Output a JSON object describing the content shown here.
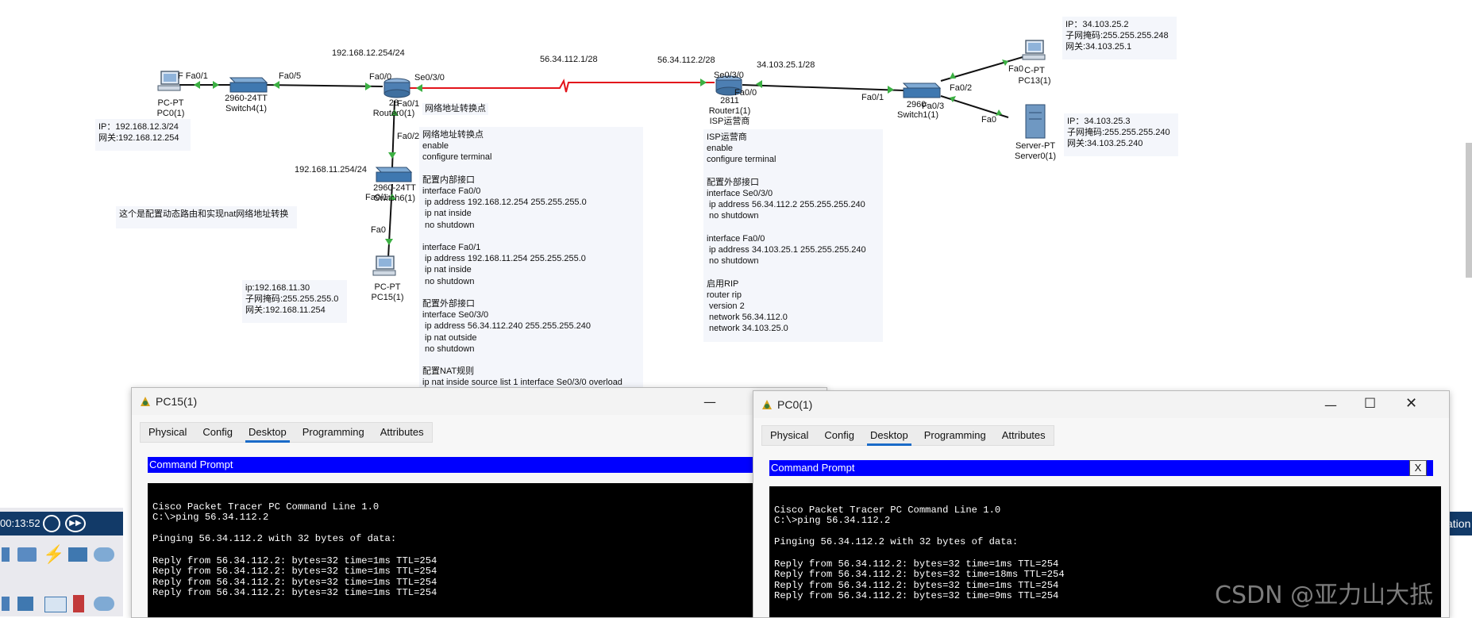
{
  "topology": {
    "devices": [
      {
        "id": "pc0",
        "type": "PC-PT",
        "name": "PC0(1)"
      },
      {
        "id": "switch4",
        "type": "2960-24TT",
        "name": "Switch4(1)"
      },
      {
        "id": "router0",
        "type": "28",
        "name": "Router0(1)"
      },
      {
        "id": "router1",
        "type": "2811",
        "name": "Router1(1)",
        "extra": "ISP运营商"
      },
      {
        "id": "switch1",
        "type": "2960-",
        "name": "Switch1(1)"
      },
      {
        "id": "pc13",
        "type": "C-PT",
        "name": "PC13(1)"
      },
      {
        "id": "server0",
        "type": "Server-PT",
        "name": "Server0(1)"
      },
      {
        "id": "switch6",
        "type": "2960-24TT",
        "name": "Switch6(1)"
      },
      {
        "id": "pc15",
        "type": "PC-PT",
        "name": "PC15(1)"
      }
    ],
    "port_labels": {
      "pc0_fa": "F Fa0/1",
      "sw4_fa05": "Fa0/5",
      "r0_fa00": "Fa0/0",
      "r0_se030": "Se0/3/0",
      "r0_fa01": "Fa0/1",
      "sw6_fa02": "Fa0/2",
      "sw6_fa01": "Fa0/1",
      "pc15_fa0": "Fa0",
      "r1_se030": "Se0/3/0",
      "r1_fa00": "Fa0/0",
      "sw1_fa01": "Fa0/1",
      "sw1_fa02": "Fa0/2",
      "sw1_fa03": "Fa0/3",
      "pc13_fa0": "Fa0",
      "server0_fa0": "Fa0"
    },
    "net_labels": {
      "lan12": "192.168.12.254/24",
      "wan_left": "56.34.112.1/28",
      "wan_right": "56.34.112.2/28",
      "lan34": "34.103.25.1/28",
      "lan11": "192.168.11.254/24",
      "nat_label": "网络地址转换点"
    },
    "colors": {
      "link": "#111111",
      "serial_link": "#e3141b",
      "port_up": "#3cb043"
    }
  },
  "notes": {
    "pc0_info": [
      "IP：192.168.12.3/24",
      "网关:192.168.12.254"
    ],
    "pc13_info": [
      "IP：34.103.25.2",
      "子网掩码:255.255.255.248",
      "网关:34.103.25.1"
    ],
    "server0_info": [
      "IP：34.103.25.3",
      "子网掩码:255.255.255.240",
      "网关:34.103.25.240"
    ],
    "pc15_info": [
      "ip:192.168.11.30",
      "子网掩码:255.255.255.0",
      "网关:192.168.11.254"
    ],
    "description": "这个是配置动态路由和实现nat网络地址转换",
    "router0_config": [
      "网络地址转换点",
      "enable",
      "configure terminal",
      "",
      "配置内部接口",
      "interface Fa0/0",
      " ip address 192.168.12.254 255.255.255.0",
      " ip nat inside",
      " no shutdown",
      "",
      "interface Fa0/1",
      " ip address 192.168.11.254 255.255.255.0",
      " ip nat inside",
      " no shutdown",
      "",
      "配置外部接口",
      "interface Se0/3/0",
      " ip address 56.34.112.240 255.255.255.240",
      " ip nat outside",
      " no shutdown",
      "",
      "配置NAT规则",
      "ip nat inside source list 1 interface Se0/3/0 overload"
    ],
    "router1_config": [
      "ISP运营商",
      "enable",
      "configure terminal",
      "",
      "配置外部接口",
      "interface Se0/3/0",
      " ip address 56.34.112.2 255.255.255.240",
      " no shutdown",
      "",
      "interface Fa0/0",
      " ip address 34.103.25.1 255.255.255.240",
      " no shutdown",
      "",
      "启用RIP",
      "router rip",
      " version 2",
      " network 56.34.112.0",
      " network 34.103.25.0"
    ]
  },
  "windows": {
    "pc15": {
      "title": "PC15(1)",
      "tabs": [
        "Physical",
        "Config",
        "Desktop",
        "Programming",
        "Attributes"
      ],
      "active_tab": "Desktop",
      "cmd_title": "Command Prompt",
      "lines": [
        "",
        "Cisco Packet Tracer PC Command Line 1.0",
        "C:\\>ping 56.34.112.2",
        "",
        "Pinging 56.34.112.2 with 32 bytes of data:",
        "",
        "Reply from 56.34.112.2: bytes=32 time=1ms TTL=254",
        "Reply from 56.34.112.2: bytes=32 time=1ms TTL=254",
        "Reply from 56.34.112.2: bytes=32 time=1ms TTL=254",
        "Reply from 56.34.112.2: bytes=32 time=1ms TTL=254"
      ]
    },
    "pc0": {
      "title": "PC0(1)",
      "tabs": [
        "Physical",
        "Config",
        "Desktop",
        "Programming",
        "Attributes"
      ],
      "active_tab": "Desktop",
      "cmd_title": "Command Prompt",
      "close_label": "X",
      "lines": [
        "",
        "Cisco Packet Tracer PC Command Line 1.0",
        "C:\\>ping 56.34.112.2",
        "",
        "Pinging 56.34.112.2 with 32 bytes of data:",
        "",
        "Reply from 56.34.112.2: bytes=32 time=1ms TTL=254",
        "Reply from 56.34.112.2: bytes=32 time=18ms TTL=254",
        "Reply from 56.34.112.2: bytes=32 time=1ms TTL=254",
        "Reply from 56.34.112.2: bytes=32 time=9ms TTL=254"
      ]
    }
  },
  "toolbar": {
    "time": "00:13:52",
    "right_edge_text": "ation"
  },
  "watermark": "CSDN @亚力山大抵"
}
